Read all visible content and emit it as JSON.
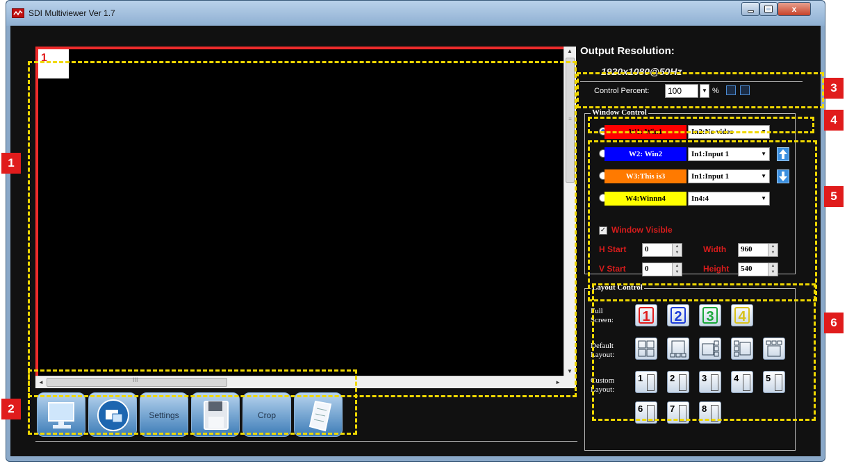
{
  "window": {
    "title": "SDI Multiviewer  Ver 1.7",
    "controls": {
      "minimize": "minimize-icon",
      "maximize": "maximize-icon",
      "close": "x"
    }
  },
  "preview": {
    "window_tag": "1",
    "scrollbar_grip": "III"
  },
  "toolbar": {
    "buttons": [
      {
        "icon": "monitor-icon",
        "label": ""
      },
      {
        "icon": "input-source-icon",
        "label": ""
      },
      {
        "icon": "",
        "label": "Settings"
      },
      {
        "icon": "save-disk-icon",
        "label": ""
      },
      {
        "icon": "",
        "label": "Crop"
      },
      {
        "icon": "notes-icon",
        "label": ""
      }
    ]
  },
  "output": {
    "heading": "Output Resolution:",
    "resolution": "1920x1080@50Hz",
    "control_percent_label": "Control Percent:",
    "control_percent_value": "100",
    "unit": "%"
  },
  "window_control": {
    "title": "Window Control",
    "windows": [
      {
        "name": "W1: Win1",
        "color": "#ff0000",
        "text_color": "#000000",
        "input": "In2:No video",
        "selected": true
      },
      {
        "name": "W2: Win2",
        "color": "#0000ff",
        "text_color": "#ffffff",
        "input": "In1:Input 1",
        "selected": false
      },
      {
        "name": "W3:This is3",
        "color": "#ff7a00",
        "text_color": "#ffffff",
        "input": "In1:Input 1",
        "selected": false
      },
      {
        "name": "W4:Winnn4",
        "color": "#ffff00",
        "text_color": "#000000",
        "input": "In4:4",
        "selected": false
      }
    ],
    "window_visible_label": "Window Visible",
    "window_visible": true,
    "h_start_label": "H Start",
    "h_start": "0",
    "v_start_label": "V Start",
    "v_start": "0",
    "width_label": "Width",
    "width": "960",
    "height_label": "Height",
    "height": "540"
  },
  "layout_control": {
    "title": "Layout Control",
    "full_screen_label": "Full Screen:",
    "full_screen": [
      {
        "label": "1",
        "color": "#e01c1c"
      },
      {
        "label": "2",
        "color": "#1c3cd8"
      },
      {
        "label": "3",
        "color": "#1aa83a"
      },
      {
        "label": "4",
        "color": "#d8c21c"
      }
    ],
    "default_layout_label": "Default Layout:",
    "default_layouts": [
      "quad-layout-icon",
      "pip-bottom-icon",
      "pip-side-icon",
      "triple-left-icon",
      "quad-top-icon"
    ],
    "custom_layout_label": "Custom Layout:",
    "custom_layouts": [
      "1",
      "2",
      "3",
      "4",
      "5",
      "6",
      "7",
      "8"
    ]
  },
  "annotations": [
    "1",
    "2",
    "3",
    "4",
    "5",
    "6"
  ],
  "colors": {
    "annotation_border": "#f0d800",
    "badge": "#e01c1c",
    "preview_frame": "#ee2b2b"
  }
}
